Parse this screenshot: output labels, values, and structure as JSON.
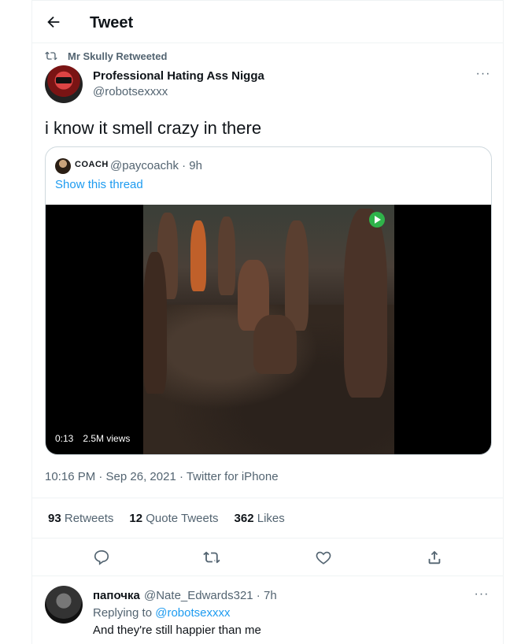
{
  "header": {
    "title": "Tweet"
  },
  "retweet": {
    "text": "Mr Skully Retweeted"
  },
  "tweet": {
    "author_name": "Professional Hating Ass Nigga",
    "author_handle": "@robotsexxxx",
    "text": "i know it smell crazy in there",
    "timestamp": "10:16 PM · Sep 26, 2021 · Twitter for iPhone"
  },
  "quote": {
    "name": "COACH",
    "handle_time": "@paycoachk · 9h",
    "thread_link": "Show this thread",
    "video": {
      "time": "0:13",
      "views": "2.5M views"
    }
  },
  "stats": [
    {
      "count": "93",
      "label": "Retweets"
    },
    {
      "count": "12",
      "label": "Quote Tweets"
    },
    {
      "count": "362",
      "label": "Likes"
    }
  ],
  "reply": {
    "name": "папочка",
    "handle_time": "@Nate_Edwards321 · 7h",
    "replying_prefix": "Replying to",
    "replying_handle": "@robotsexxxx",
    "text": "And they're still happier than me"
  },
  "colors": {
    "accent": "#1d9bf0",
    "muted": "#536471",
    "text": "#0f1419",
    "border": "#eff3f4"
  }
}
